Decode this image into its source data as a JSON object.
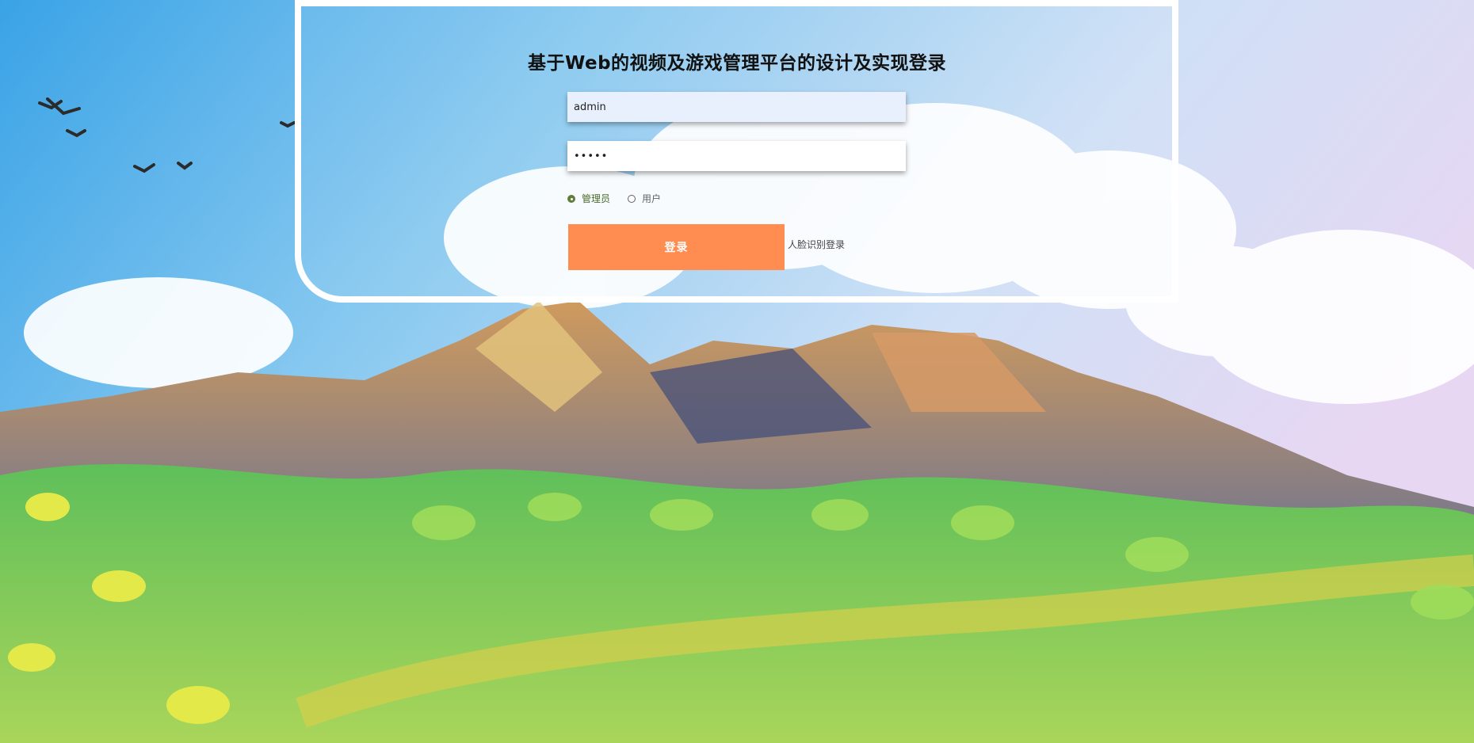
{
  "page": {
    "title": "基于Web的视频及游戏管理平台的设计及实现登录"
  },
  "form": {
    "username_value": "admin",
    "password_mask": "•••••",
    "roles": [
      {
        "label": "管理员",
        "selected": true
      },
      {
        "label": "用户",
        "selected": false
      }
    ],
    "login_button": "登录",
    "face_login_link": "人脸识别登录"
  },
  "colors": {
    "accent": "#ff8c50",
    "sky": "#4fb3ec",
    "selected_radio": "#607d3b"
  }
}
